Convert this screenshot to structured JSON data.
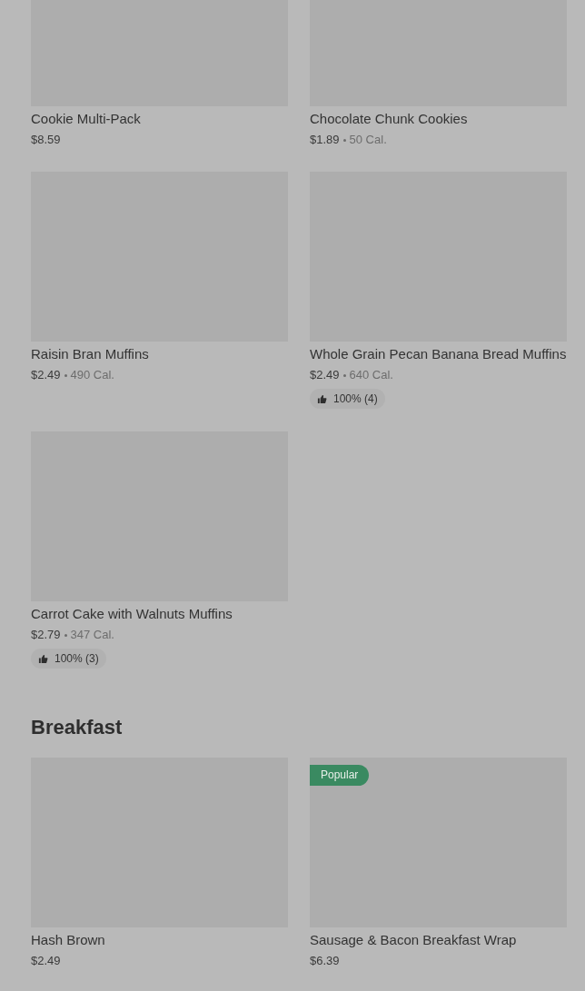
{
  "sections": [
    {
      "items": [
        {
          "name": "Cookie Multi-Pack",
          "price": "$8.59"
        },
        {
          "name": "Chocolate Chunk Cookies",
          "price": "$1.89",
          "calories": "50 Cal."
        },
        {
          "name": "Raisin Bran Muffins",
          "price": "$2.49",
          "calories": "490 Cal."
        },
        {
          "name": "Whole Grain Pecan Banana Bread Muffins",
          "price": "$2.49",
          "calories": "640 Cal.",
          "rating": "100% (4)"
        },
        {
          "name": "Carrot Cake with Walnuts Muffins",
          "price": "$2.79",
          "calories": "347 Cal.",
          "rating": "100% (3)"
        }
      ]
    },
    {
      "title": "Breakfast",
      "items": [
        {
          "name": "Hash Brown",
          "price": "$2.49"
        },
        {
          "name": "Sausage & Bacon Breakfast Wrap",
          "price": "$6.39",
          "badge": "Popular"
        }
      ]
    }
  ]
}
